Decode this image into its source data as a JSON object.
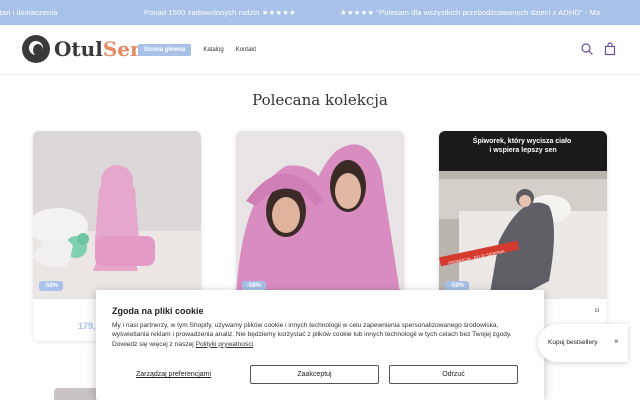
{
  "marquee": {
    "items": [
      "ytań i ilomaczenia",
      "Ponad 1500 zadowolonych rodzin ★★★★★",
      "★★★★★ \"Polecam dla wszystkich przebodźcowanych dzieci z ADHD\" - Ma"
    ]
  },
  "header": {
    "logo_part1": "Otul",
    "logo_part2": "Sen",
    "nav": [
      "Strona główna",
      "Katalog",
      "Kontakt"
    ],
    "icons": [
      "search-icon",
      "bag-icon"
    ]
  },
  "section": {
    "title": "Polecana kolekcja"
  },
  "products": [
    {
      "badge": "-58%",
      "price": "179,",
      "name": ""
    },
    {
      "badge": "-58%",
      "price": "",
      "name": ""
    },
    {
      "badge": "-58%",
      "price": "",
      "name": "ci",
      "image_headline": "Śpiworek, który wycisza ciało i wspiera lepszy sen",
      "image_ribbon": "PROMOCJA - DO 31 SIERPNIA"
    }
  ],
  "cookie": {
    "title": "Zgoda na pliki cookie",
    "body": "My i nasi partnerzy, w tym Shopify, używamy plików cookie i innych technologii w celu zapewnienia spersonalizowanego środowiska, wyświetlania reklam i prowadzenia analiz. Nie będziemy korzystać z plików cookie lub innych technologii w tych celach bez Twojej zgody. Dowiedz się więcej z naszej",
    "privacy_link": "Polityki prywatności",
    "manage_label": "Zarządzaj preferencjami",
    "accept_label": "Zaakceptuj",
    "reject_label": "Odrzuć"
  },
  "bestseller": {
    "label": "Kupuj bestsellery",
    "close": "×"
  },
  "colors": {
    "accent": "#a7c1e8",
    "logo_dark": "#3a3a3a",
    "logo_orange": "#e58a62"
  }
}
